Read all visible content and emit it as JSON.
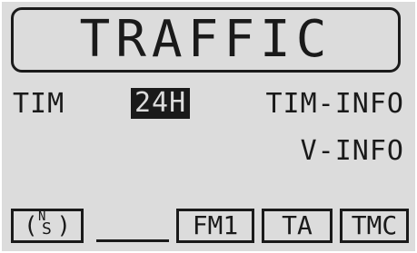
{
  "display": {
    "title": "TRAFFIC",
    "tim_label": "TIM",
    "time_mode": "24H",
    "tim_info": "TIM-INFO",
    "v_info": "V-INFO"
  },
  "status_bar": {
    "ns_indicator_n": "N",
    "ns_indicator_s": "S",
    "band": "FM1",
    "ta": "TA",
    "tmc": "TMC"
  }
}
